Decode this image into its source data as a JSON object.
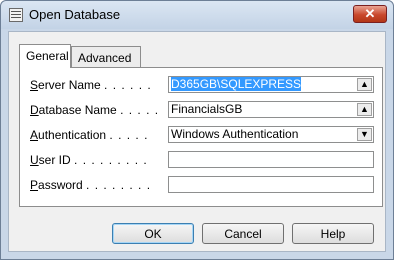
{
  "window": {
    "title": "Open Database",
    "close_glyph": "✕",
    "app_icon": "window-app-icon"
  },
  "tabs": [
    {
      "label": "General",
      "active": true
    },
    {
      "label": "Advanced",
      "active": false
    }
  ],
  "form": {
    "server_name": {
      "label_accel": "S",
      "label_rest": "erver Name",
      "dots": ". . . . . .",
      "value": "D365GB\\SQLEXPRESS",
      "button_glyph": "▲",
      "button_icon": "lookup-up-arrow-icon"
    },
    "database_name": {
      "label_accel": "D",
      "label_rest": "atabase Name",
      "dots": ". . . . .",
      "value": "FinancialsGB",
      "button_glyph": "▲",
      "button_icon": "lookup-up-arrow-icon"
    },
    "authentication": {
      "label_accel": "A",
      "label_rest": "uthentication",
      "dots": ". . . . .",
      "value": "Windows Authentication",
      "button_glyph": "▼",
      "button_icon": "chevron-down-icon"
    },
    "user_id": {
      "label_accel": "U",
      "label_rest": "ser ID",
      "dots": ". . . . . . . . .",
      "value": ""
    },
    "password": {
      "label_accel": "P",
      "label_rest": "assword",
      "dots": ". . . . . . . .",
      "value": ""
    }
  },
  "buttons": {
    "ok": "OK",
    "cancel": "Cancel",
    "help": "Help"
  },
  "colors": {
    "title_bar": "#c9d7e8",
    "selection": "#3399ff",
    "close_button": "#c9482c"
  }
}
